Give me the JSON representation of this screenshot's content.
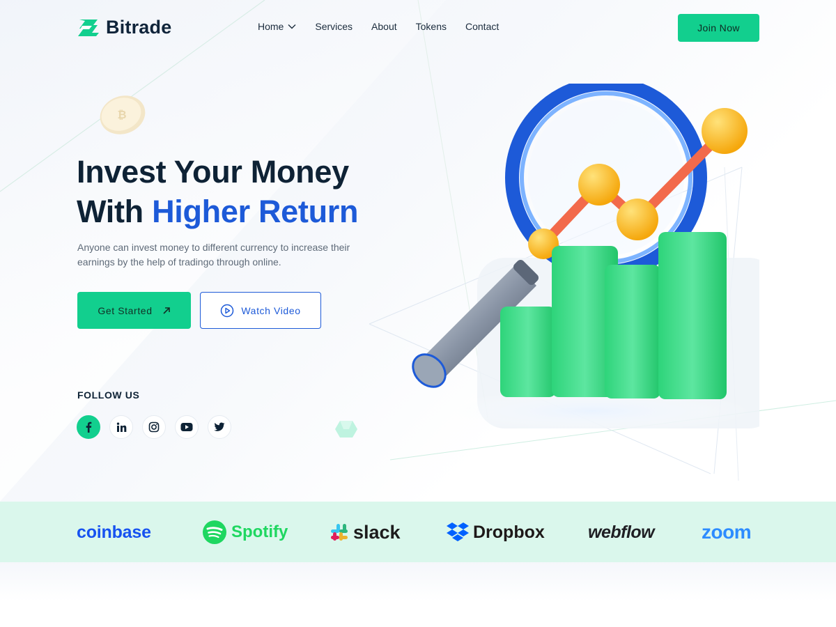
{
  "brand": {
    "name": "Bitrade",
    "accent": "#12CF8E",
    "blue": "#1D5AD8"
  },
  "nav": {
    "items": [
      {
        "label": "Home",
        "has_dropdown": true
      },
      {
        "label": "Services"
      },
      {
        "label": "About"
      },
      {
        "label": "Tokens"
      },
      {
        "label": "Contact"
      }
    ],
    "cta": "Join Now"
  },
  "hero": {
    "title_line1": "Invest Your Money",
    "title_line2_plain": "With ",
    "title_line2_accent": "Higher Return",
    "subtitle": "Anyone can invest money to different currency to increase their earnings by the help of tradingo through online.",
    "primary_button": "Get Started",
    "secondary_button": "Watch Video"
  },
  "follow": {
    "label": "FOLLOW US",
    "socials": [
      "facebook-icon",
      "linkedin-icon",
      "instagram-icon",
      "youtube-icon",
      "twitter-icon"
    ]
  },
  "partners": [
    "coinbase",
    "Spotify",
    "slack",
    "Dropbox",
    "webflow",
    "zoom"
  ]
}
